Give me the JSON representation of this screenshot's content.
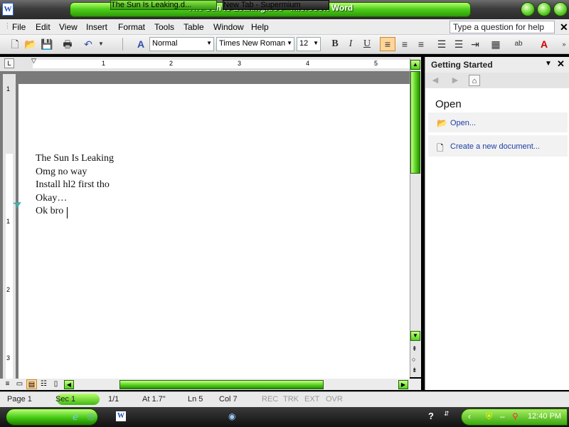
{
  "window": {
    "title": "The Sun Is Leaking.doc - Microsoft Word"
  },
  "menu": {
    "items": [
      "File",
      "Edit",
      "View",
      "Insert",
      "Format",
      "Tools",
      "Table",
      "Window",
      "Help"
    ],
    "help_placeholder": "Type a question for help"
  },
  "toolbar": {
    "style": "Normal",
    "font": "Times New Roman",
    "size": "12",
    "bold": "B",
    "italic": "I",
    "underline": "U",
    "highlight_label": "ab"
  },
  "ruler": {
    "numbers": [
      "1",
      "2",
      "3",
      "4",
      "5"
    ],
    "vnumbers": [
      "1",
      "1",
      "2",
      "3"
    ]
  },
  "document": {
    "lines": [
      "The Sun Is Leaking",
      "Omg no way",
      "Install hl2 first tho",
      "Okay…",
      "Ok bro"
    ]
  },
  "task_pane": {
    "title": "Getting Started",
    "section": "Open",
    "links": [
      "Open...",
      "Create a new document..."
    ]
  },
  "status": {
    "page": "Page  1",
    "sec": "Sec  1",
    "pages": "1/1",
    "at": "At  1.7\"",
    "ln": "Ln  5",
    "col": "Col  7",
    "rec": "REC",
    "trk": "TRK",
    "ext": "EXT",
    "ovr": "OVR"
  },
  "taskbar": {
    "tasks": [
      "The Sun Is Leaking.d...",
      "New Tab - Supermium"
    ],
    "clock": "12:40 PM"
  },
  "colors": {
    "accent_green": "#54d11c",
    "link_blue": "#1c3fa8"
  }
}
